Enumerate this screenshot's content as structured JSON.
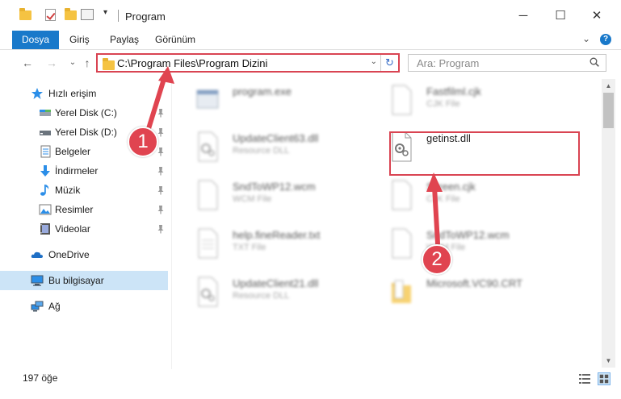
{
  "window": {
    "title": "Program",
    "minimize": "─",
    "maximize": "☐",
    "close": "✕"
  },
  "ribbon": {
    "tabs": [
      "Dosya",
      "Giriş",
      "Paylaş",
      "Görünüm"
    ]
  },
  "address": {
    "path": "C:\\Program Files\\Program Dizini",
    "dropdown": "⌄",
    "refresh": "↻"
  },
  "search": {
    "placeholder": "Ara: Program"
  },
  "nav": {
    "back": "←",
    "forward": "→",
    "recent": "⌄",
    "up": "↑"
  },
  "navpane": {
    "items": [
      {
        "label": "Hızlı erişim",
        "icon": "star-icon"
      },
      {
        "label": "Yerel Disk (C:)",
        "icon": "drive-icon"
      },
      {
        "label": "Yerel Disk (D:)",
        "icon": "drive-icon"
      },
      {
        "label": "Belgeler",
        "icon": "documents-icon"
      },
      {
        "label": "İndirmeler",
        "icon": "download-icon"
      },
      {
        "label": "Müzik",
        "icon": "music-icon"
      },
      {
        "label": "Resimler",
        "icon": "pictures-icon"
      },
      {
        "label": "Videolar",
        "icon": "videos-icon"
      },
      {
        "label": "OneDrive",
        "icon": "cloud-icon"
      },
      {
        "label": "Bu bilgisayar",
        "icon": "computer-icon"
      },
      {
        "label": "Ağ",
        "icon": "network-icon"
      }
    ]
  },
  "files": [
    {
      "name": "program.exe",
      "type": ""
    },
    {
      "name": "Fastfilml.cjk",
      "type": "CJK File"
    },
    {
      "name": "UpdateClient63.dll",
      "type": "Resource DLL"
    },
    {
      "name": "getinst.dll",
      "type": ""
    },
    {
      "name": "SndToWP12.wcm",
      "type": "WCM File"
    },
    {
      "name": "Screen.cjk",
      "type": "CJK File"
    },
    {
      "name": "help.fineReader.txt",
      "type": "TXT File"
    },
    {
      "name": "SndToWP12.wcm",
      "type": "WCM File"
    },
    {
      "name": "UpdateClient21.dll",
      "type": "Resource DLL"
    },
    {
      "name": "Microsoft.VC90.CRT",
      "type": ""
    }
  ],
  "status": {
    "count": "197 öğe"
  },
  "annotations": {
    "step1": "1",
    "step2": "2",
    "color": "#e04450"
  },
  "colors": {
    "accent": "#1979ca",
    "highlight": "#d94452",
    "selected": "#cce4f7"
  }
}
